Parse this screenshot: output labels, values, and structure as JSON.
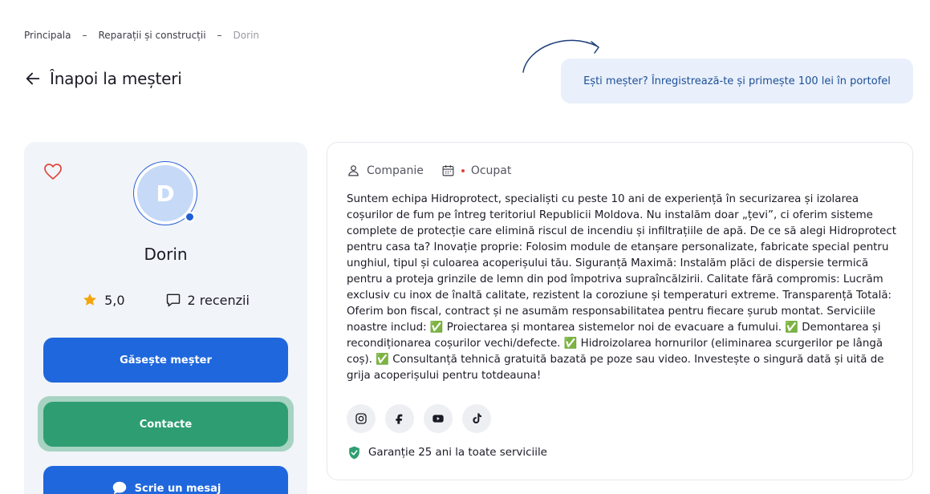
{
  "breadcrumb": {
    "items": [
      "Principala",
      "Reparații și construcții",
      "Dorin"
    ],
    "separator": "–"
  },
  "back": {
    "label": "Înapoi la meșteri"
  },
  "promo": {
    "text": "Ești meșter? Înregistrează-te și primește 100 lei în portofel"
  },
  "profile": {
    "initial": "D",
    "name": "Dorin",
    "rating": "5,0",
    "reviews": "2 recenzii",
    "find_button": "Găsește meșter",
    "contact_button": "Contacte",
    "message_button": "Scrie un mesaj"
  },
  "details": {
    "type": "Companie",
    "status": "Ocupat",
    "description": "Suntem echipa Hidroprotect, specialiști cu peste 10 ani de experiență în securizarea și izolarea coșurilor de fum pe întreg teritoriul Republicii Moldova. Nu instalăm doar „țevi”, ci oferim sisteme complete de protecție care elimină riscul de incendiu și infiltrațiile de apă. De ce să alegi Hidroprotect pentru casa ta? Inovație proprie: Folosim module de etanșare personalizate, fabricate special pentru unghiul, tipul și culoarea acoperișului tău. Siguranță Maximă: Instalăm plăci de dispersie termică pentru a proteja grinzile de lemn din pod împotriva supraîncălzirii. Calitate fără compromis: Lucrăm exclusiv cu inox de înaltă calitate, rezistent la coroziune și temperaturi extreme. Transparență Totală: Oferim bon fiscal, contract și ne asumăm responsabilitatea pentru fiecare șurub montat. Serviciile noastre includ: ✅ Proiectarea și montarea sistemelor noi de evacuare a fumului. ✅ Demontarea și recondiționarea coșurilor vechi/defecte. ✅ Hidroizolarea hornurilor (eliminarea scurgerilor pe lângă coș). ✅ Consultanță tehnică gratuită bazată pe poze sau video. Investește o singură dată și uită de grija acoperișului pentru totdeauna!",
    "guarantee": "Garanție 25 ani la toate serviciile"
  },
  "socials": [
    {
      "icon": "instagram-icon"
    },
    {
      "icon": "facebook-icon"
    },
    {
      "icon": "youtube-icon"
    },
    {
      "icon": "tiktok-icon"
    }
  ],
  "colors": {
    "primary": "#1f67dc",
    "contact": "#2e9e72",
    "promo_bg": "#e9f0fb",
    "promo_text": "#1d4f97",
    "star": "#f2a50c",
    "heart": "#e0453a",
    "shield": "#2e9e72"
  }
}
